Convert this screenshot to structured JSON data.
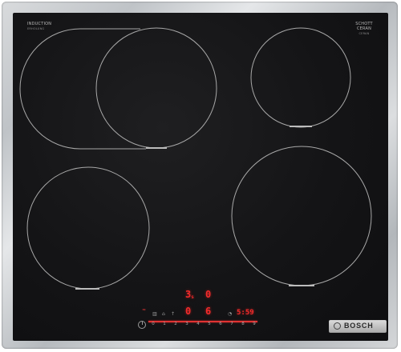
{
  "appliance": {
    "brand": "BOSCH",
    "left_label": "INDUCTION",
    "left_sublabel": "ERHOLUNG",
    "right_label_1": "SCHOTT",
    "right_label_2": "CERAN",
    "right_sublabel": "CERAN"
  },
  "display": {
    "zone_top_left": "3",
    "zone_top_left_sup": "s",
    "zone_top_right": "0",
    "zone_bottom_left": "0",
    "zone_bottom_right": "6",
    "timer": "5:59"
  },
  "slider": {
    "scale": [
      "0",
      "1",
      "2",
      "3",
      "4",
      "5",
      "6",
      "7",
      "8",
      "9"
    ]
  },
  "colors": {
    "glass": "#141416",
    "display_red": "#f22b2b",
    "zone_outline": "#a8a8a8",
    "frame": "#c7cacd"
  }
}
